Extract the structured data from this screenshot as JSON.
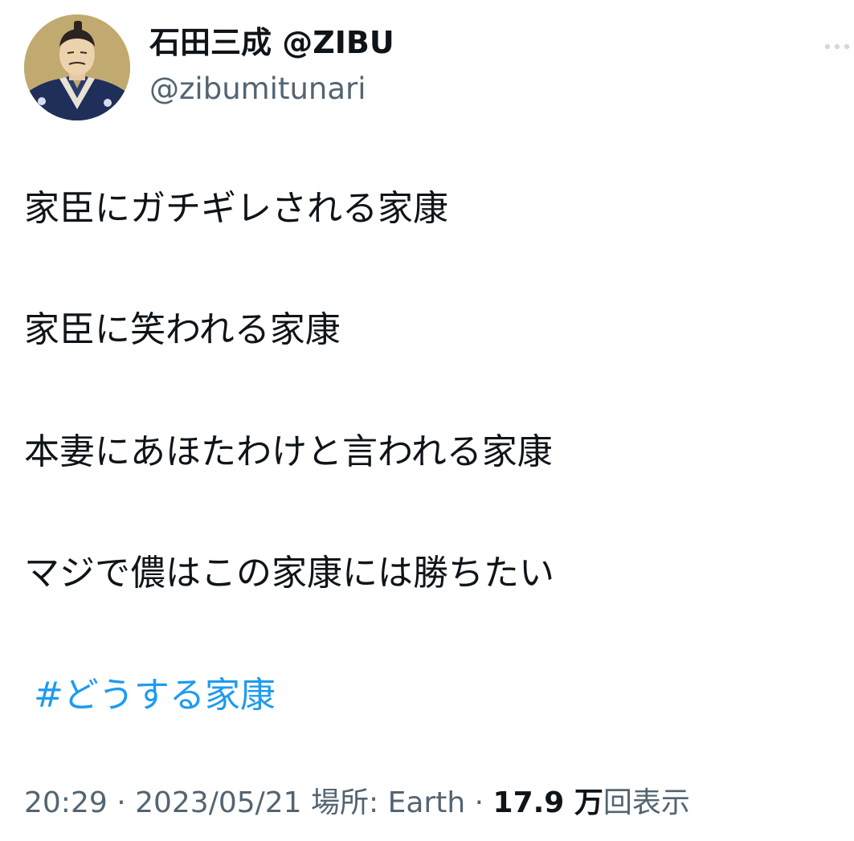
{
  "author": {
    "display_name": "石田三成 @ZIBU",
    "handle": "@zibumitunari"
  },
  "tweet": {
    "lines": [
      "家臣にガチギレされる家康",
      "家臣に笑われる家康",
      "本妻にあほたわけと言われる家康",
      "マジで儂はこの家康には勝ちたい"
    ],
    "hashtag": "#どうする家康"
  },
  "meta": {
    "time": "20:29",
    "date": "2023/05/21",
    "separator": " · ",
    "location_label": "場所: ",
    "location": "Earth",
    "views_count": "17.9 万",
    "views_label": "回表示"
  },
  "icons": {
    "more": "more-dots-icon",
    "avatar": "samurai-portrait"
  },
  "colors": {
    "text": "#0f1419",
    "secondary": "#536471",
    "link": "#1d9bf0"
  }
}
